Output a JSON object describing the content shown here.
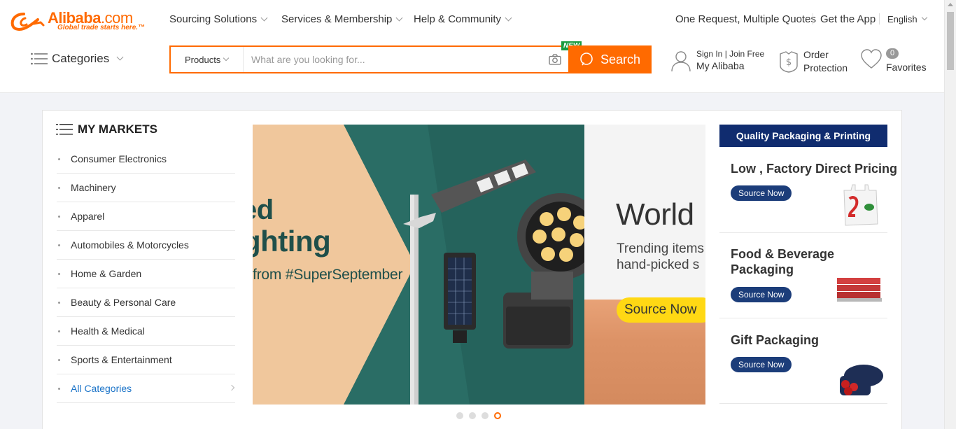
{
  "logo": {
    "name": "Alibaba",
    "domain": ".com",
    "tagline": "Global trade starts here.™"
  },
  "nav": {
    "sourcing": "Sourcing Solutions",
    "services": "Services & Membership",
    "help": "Help & Community",
    "quotes": "One Request, Multiple Quotes",
    "app": "Get the App",
    "language": "English"
  },
  "search": {
    "categories_label": "Categories",
    "product_type": "Products",
    "placeholder": "What are you looking for...",
    "button": "Search",
    "new_badge": "NEW"
  },
  "account": {
    "sign_in": "Sign In",
    "join": "Join Free",
    "my_alibaba": "My Alibaba",
    "order": "Order",
    "protection": "Protection",
    "favorites": "Favorites",
    "favorites_count": "0"
  },
  "markets": {
    "title": "MY MARKETS",
    "items": [
      "Consumer Electronics",
      "Machinery",
      "Apparel",
      "Automobiles & Motorcycles",
      "Home & Garden",
      "Beauty & Personal Care",
      "Health & Medical",
      "Sports & Entertainment"
    ],
    "all": "All Categories"
  },
  "banner": {
    "headline1": "ed",
    "headline2": "ghting",
    "sub": "from #SuperSeptember",
    "world": "World",
    "trend_line1": "Trending items",
    "trend_line2": "hand-picked s",
    "cta": "Source Now",
    "slide_count": 4,
    "active_slide": 4
  },
  "packaging": {
    "header": "Quality Packaging & Printing",
    "cards": [
      {
        "title": "Low , Factory Direct Pricing",
        "button": "Source Now"
      },
      {
        "title": "Food & Beverage Packaging",
        "button": "Source Now"
      },
      {
        "title": "Gift Packaging",
        "button": "Source Now"
      }
    ]
  },
  "colors": {
    "brand": "#ff6a00",
    "navy": "#102c6f",
    "link": "#1a73c8",
    "banner_teal": "#2a6d65"
  }
}
